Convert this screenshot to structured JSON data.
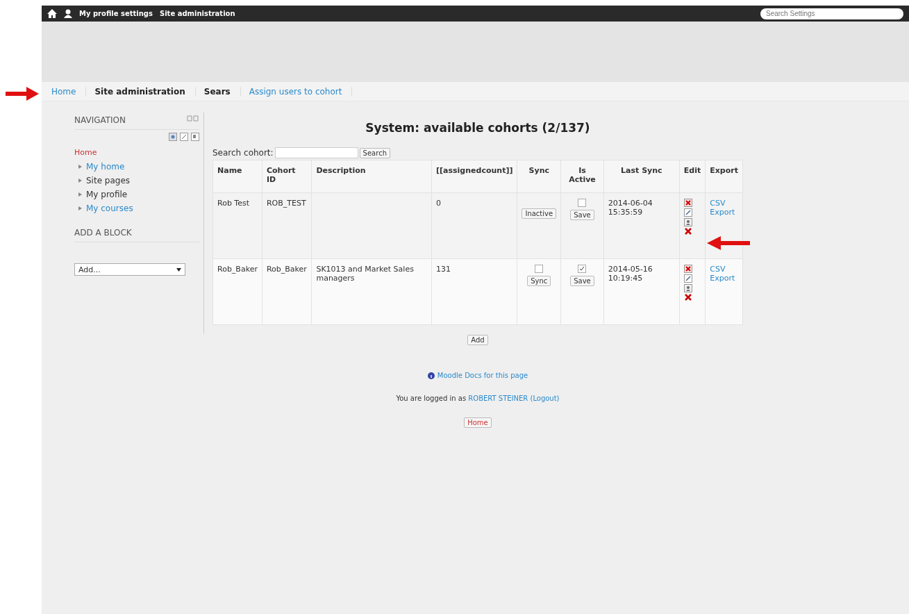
{
  "topbar": {
    "links": [
      "My profile settings",
      "Site administration"
    ],
    "search": {
      "placeholder": "Search Settings"
    }
  },
  "breadcrumb": [
    {
      "label": "Home",
      "kind": "link"
    },
    {
      "label": "Site administration",
      "kind": "plain"
    },
    {
      "label": "Sears",
      "kind": "plain"
    },
    {
      "label": "Assign users to cohort",
      "kind": "link"
    }
  ],
  "navigation": {
    "title": "NAVIGATION",
    "root": "Home",
    "items": [
      {
        "label": "My home",
        "kind": "link"
      },
      {
        "label": "Site pages",
        "kind": "plain"
      },
      {
        "label": "My profile",
        "kind": "plain"
      },
      {
        "label": "My courses",
        "kind": "link"
      }
    ]
  },
  "add_block": {
    "title": "ADD A BLOCK",
    "select": "Add..."
  },
  "heading": "System: available cohorts (2/137)",
  "search": {
    "label": "Search cohort:",
    "button": "Search"
  },
  "table": {
    "columns": [
      "Name",
      "Cohort ID",
      "Description",
      "[[assignedcount]]",
      "Sync",
      "Is Active",
      "Last Sync",
      "Edit",
      "Export"
    ],
    "rows": [
      {
        "name": "Rob Test",
        "cohort_id": "ROB_TEST",
        "description": "",
        "count": "0",
        "sync_button": "Inactive",
        "active": false,
        "save": "Save",
        "last_sync": "2014-06-04 15:35:59",
        "export": "CSV Export"
      },
      {
        "name": "Rob_Baker",
        "cohort_id": "Rob_Baker",
        "description": "SK1013 and Market Sales managers",
        "count": "131",
        "sync_checkbox": {
          "checked": false
        },
        "sync_button": "Sync",
        "active": true,
        "save": "Save",
        "last_sync": "2014-05-16 10:19:45",
        "export": "CSV Export"
      }
    ]
  },
  "add_button": "Add",
  "footer": {
    "docs": "Moodle Docs for this page",
    "logged_in": "You are logged in as",
    "user": "ROBERT STEINER",
    "logout": "(Logout)",
    "home_button": "Home"
  }
}
